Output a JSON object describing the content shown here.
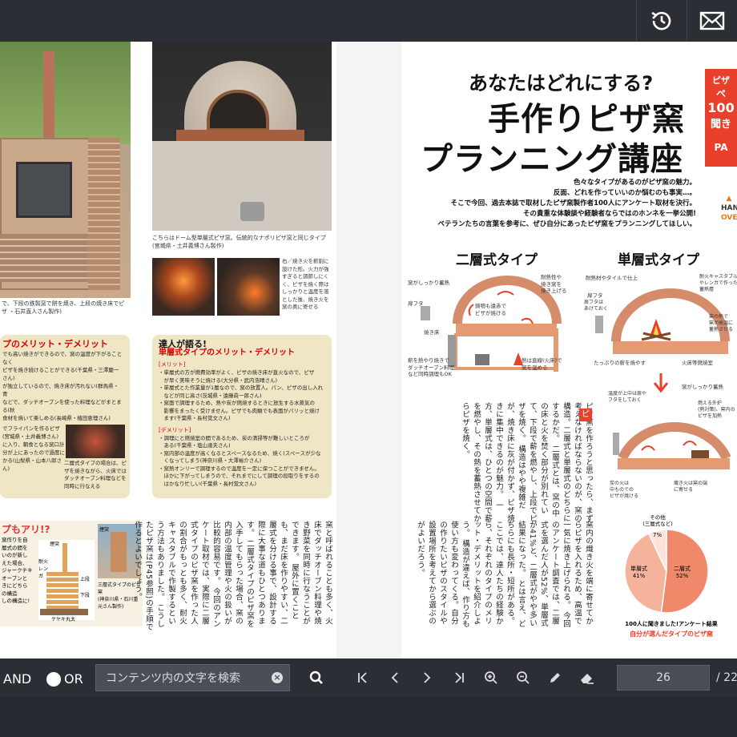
{
  "toolbar": {
    "history_icon": "history-icon",
    "mail_icon": "mail-icon"
  },
  "left_page": {
    "caption_tl": "で、下段の鉄製窯で餅を焼き、上段の焼き床でピザ\n・石井直人さん製作)",
    "caption_tr": "こちらはドーム型単層式ピザ窯。伝統的なナポリピザ窯と同じタイプ(宮城県・土井義博さん製作)",
    "caption_mid": "右／焼き火を薪割に設けた形。火力が強すぎると調節しにくく、ピザを焼く際はしっかりと温度を落とした後、焼き火を窯の奥に寄せる",
    "merit_a_head": "プのメリット・デメリット",
    "merit_a_body": "でも高い焼きができるので、窯の温度が下がることなく\nピザを焼き続けることができる(千葉県・三澤慶一さん)\nが独立しているので、焼き床が汚れない(群馬県・青\nなどで、ダッチオーブンを使った料理などがまとまる(秋\n食材を焼いて楽しめる(長崎県・植田恵理さん)",
    "merit_a_side": "でフライパンを作るピザ\n(宮城県・土井義博さん)\nに入り、朝食となる窯口計\n分が上にあったので過度に\nかる(山梨県・山本八郎さん)",
    "merit_a_inset": "二層式タイプの場合は、ピザを焼きながら、火床ではダッチオーブン料理などを同時に行なえる",
    "merit_b_head": "達人が語る!",
    "merit_b_head2": "単層式タイプのメリット・デメリット",
    "merit_b_tag1": "[メリット]",
    "merit_b_body1": "・単層式の方が燃費効率がよく、ピザの焼き床が直火なので、ピザ\n　が早く美味そうに焼ける(大分県・武内浩晴さん)\n・単層式とた作業量が1層なので、窯の放置人。パン、ピザの出し入れ\n　などが同じ高さ(茨城県・遠藤眞一郎さん)\n・窯面で調理するため、熱や炭が燃焼するときに放生する水蒸気の\n　影響をまったく受けません。ピザでも肉類でも表面がパリッと焼け\n　ます(千葉県・長村覚文さん)",
    "merit_b_tag2": "[デメリット]",
    "merit_b_body2": "・調理にと燃焼室の間であるため、炭の清掃等が難しいところが\n　ある(千葉県・塩山達夫さん)\n・窯内部の温度が高くなるとスペースなるため、焼く(スペースが少な\n　くなってしまう(神奈川県・大澤裕介さん)\n・窯熱オンリーで調理するので温度を一定に保つことができません。\n　ほかに下がってしまうので、それまでにして調理の段取りをするの\n　はかなり忙しい(千葉県・長村覚文さん)",
    "bottom_head": "プもアリ!?",
    "bottom_body": "窯作りを自\n層式の間を\nいのが新し\nえた場合、\nジャークチキ\nオーブンと\nきにどちら\nの構造\nしの構造に!",
    "diagram_labels": [
      "煙突",
      "耐火レンガ",
      "上段",
      "下段",
      "ケヤキ丸太",
      "煙突"
    ],
    "diagram_caption": "三層式タイプのピザ窯\n(神奈川県・石川重元さん製作)",
    "vtext": [
      "窯と呼ばれることも多く、火床でダッチオーブン料理や焼き野菜を同時に行なうことができます。",
      "屋外に置くことも、まだ床を作りやすい、二層式を分ける事で、設計する際に大事な道もひとつあります。",
      "二層式タイプのピザ窯を入手してもらった場合、窯の内部の温度管理や火の扱いが比較的容易です。",
      "今回のアンケート取材では、実際に二層式タイプのピザ窯を作った人の割合がもっとも多く、耐火キャスタブルで作製するという方法もありました。",
      "こうしたピザ窯は(P45参照)の手順で作るとよいでしょう。"
    ]
  },
  "right_page": {
    "headline_small": "あなたはどれにする?",
    "headline_1": "手作りピザ窯",
    "headline_2": "プランニング講座",
    "badge_line1": "ピザ",
    "badge_line2": "ペ",
    "badge_line3": "100",
    "badge_line4": "聞き",
    "badge_line5": "PA",
    "lead_1": "色々なタイプがあるのがピザ窯の魅力。",
    "lead_2": "反面、どれを作っていいのか悩むのも事実…。",
    "lead_3": "そこで今回、過去本誌で取材したピザ窯製作者100人にアンケート取材を決行。",
    "lead_4": "その貴重な体験談や経験者ならではのホンネを一挙公開!",
    "lead_5": "ベテランたちの言葉を参考に、ぜひ自分にあったピザ窯をプランニングしてほしい。",
    "logo_line1": "HAN",
    "logo_line2": "OVE",
    "type_double": "二層式タイプ",
    "type_single": "単層式タイプ",
    "dbl_labels": [
      "窯がしっかり蓄熱",
      "扉フタ",
      "焼き床",
      "薪を熱やり焼きで\nダッチオーブン料理\nなど同時調理もOK",
      "耐熱性や\n焼き窯を\n焼き上げる",
      "鋳物も遠赤で\nピザが焼ける",
      "熱は直線(火床)で\n窯を温める"
    ],
    "sgl_labels": [
      "耐熱材やタイルで仕上",
      "扉フタ",
      "扉フタは\nあけておく",
      "耐火キャスタブル\nやレンガで作った\n蓄熱層",
      "窯の熱で\n窯が高温に\n蓄熱させる",
      "たっぷりの薪を焼やす",
      "火床等燃焼室"
    ],
    "sgl2_labels": [
      "温度が上中は扉や\nフタをしておく",
      "窯がしっかり蓄熱",
      "燃える外炉\n(熱対策)、窯内の\nピザを加熱",
      "炭の火は\n中ものでの\nピザが焼ける",
      "熾き火は窯の端\nに寄せる"
    ],
    "arrow_icon": "down-arrow-icon",
    "vtext": [
      "ピザ窯を作ろうと思ったら、まず考えなければならないのが、窯の構造。二層式と単層式のどちらにするかだ。",
      "二層式とは、窯の中の床と火を焚く部分が別れていて、下段で薪を燃やし、上段でピザを焼く。",
      "構造はやや複雑だが、焼き床に灰が付かず、ピザ焼きに集中できるのが魅力。",
      "一方、単層式は、ひとつの空間で薪を燃やし、その熱を蓄熱させてからピザを焼く。",
      "窯内の熾き火を端に寄せてからピザを入れるため、高温で一気に焼き上げられる。",
      "今回のアンケート調査では、二層式を選んだ人が52%、単層式が41%と、二層式がやや多い結果になった。",
      "とは言え、どちらにも長所・短所がある。ここでは、達人たちの経験から、それぞれのタイプのメリット・デメリットを紹介しよう。",
      "構造が違えば、作り方も使い方も変わってくる。自分の作りたいピザのスタイルや設置場所を考えてから選ぶのがよいだろう。"
    ],
    "pie_note_other": "その他\n(三層式など)",
    "pie_other_pct": "7%",
    "pie_single_label": "単層式",
    "pie_single_pct": "41%",
    "pie_double_label": "二層式",
    "pie_double_pct": "52%",
    "pie_caption1": "100人に聞きました!アンケート結果",
    "pie_caption2": "自分が選んだタイプのピザ窯"
  },
  "chart_data": {
    "type": "pie",
    "categories": [
      "二層式",
      "単層式",
      "その他(三層式など)"
    ],
    "values": [
      52,
      41,
      7
    ],
    "title": "100人に聞きました!アンケート結果 自分が選んだタイプのピザ窯",
    "colors": [
      "#f0896a",
      "#f5b39c",
      "#fbe3d9"
    ]
  },
  "bottom_bar": {
    "and_label": "AND",
    "or_label": "OR",
    "search_placeholder": "コンテンツ内の文字を検索",
    "clear_icon": "clear-icon",
    "search_icon": "search-icon",
    "first_icon": "first-page-icon",
    "prev_icon": "prev-page-icon",
    "next_icon": "next-page-icon",
    "last_icon": "last-page-icon",
    "zoom_in_icon": "zoom-in-icon",
    "zoom_out_icon": "zoom-out-icon",
    "pen_icon": "pen-icon",
    "eraser_icon": "eraser-icon",
    "current_page": "26",
    "page_sep": "/ 22"
  }
}
